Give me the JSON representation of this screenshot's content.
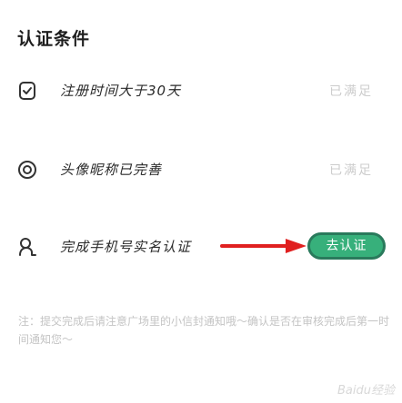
{
  "section": {
    "title": "认证条件"
  },
  "conditions": [
    {
      "label": "注册时间大于30天",
      "status": "已满足",
      "icon": "shield-check-icon"
    },
    {
      "label": "头像昵称已完善",
      "status": "已满足",
      "icon": "target-icon"
    },
    {
      "label": "完成手机号实名认证",
      "status": "",
      "icon": "user-icon",
      "action": "去认证"
    }
  ],
  "note": {
    "text": "注：提交完成后请注意广场里的小信封通知哦～确认是否在审核完成后第一时间通知您～"
  },
  "watermark": {
    "text": "Baidu经验"
  },
  "colors": {
    "action_button": "#37b07b",
    "arrow": "#e02020",
    "status_text": "#cccccc"
  }
}
